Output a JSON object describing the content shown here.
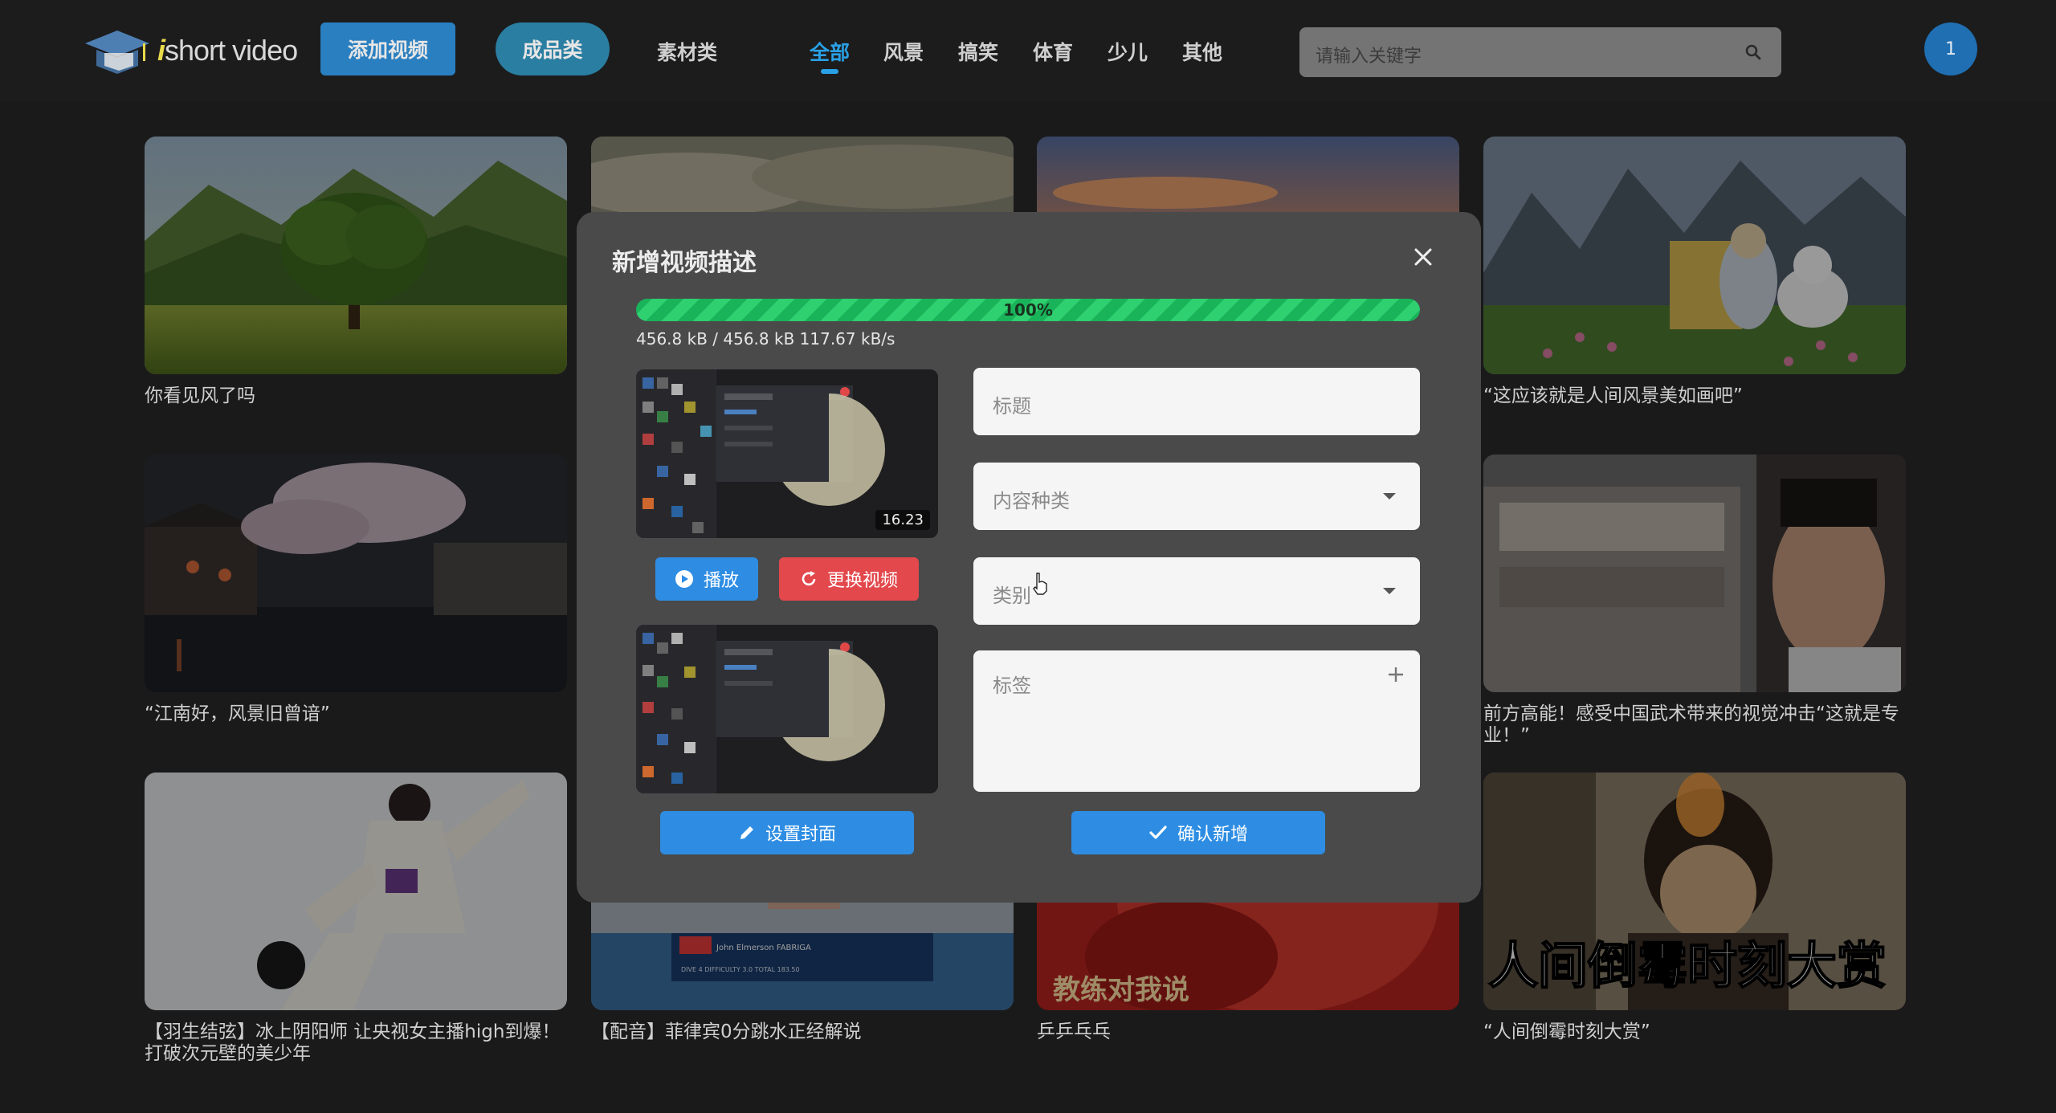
{
  "header": {
    "logo_text": "short video",
    "add_video_label": "添加视频",
    "finished_label": "成品类",
    "material_label": "素材类",
    "categories": [
      "全部",
      "风景",
      "搞笑",
      "体育",
      "少儿",
      "其他"
    ],
    "active_category": "全部",
    "search_placeholder": "请输入关键字",
    "avatar_text": "1"
  },
  "cards": [
    {
      "caption": "你看见风了吗"
    },
    {
      "caption": ""
    },
    {
      "caption": ""
    },
    {
      "caption": "“这应该就是人间风景美如画吧”"
    },
    {
      "caption": "“江南好，风景旧曾谙”"
    },
    {
      "caption": ""
    },
    {
      "caption": ""
    },
    {
      "caption": "前方高能！感受中国武术带来的视觉冲击“这就是专业！”"
    },
    {
      "caption": "【羽生结弦】冰上阴阳师 让央视女主播high到爆！打破次元壁的美少年"
    },
    {
      "caption": "【配音】菲律宾0分跳水正经解说"
    },
    {
      "caption": "乒乒乓乓"
    },
    {
      "caption": "“人间倒霉时刻大赏”"
    }
  ],
  "thumb_overlays": {
    "dive_name": "John Elmerson FABRIGA",
    "dive_bar": "DIVE 4       DIFFICULTY 3.0       TOTAL  183.50",
    "coach_text": "教练对我说",
    "unlucky_text": "人间倒霉时刻大赏"
  },
  "modal": {
    "title": "新增视频描述",
    "progress_percent": 100,
    "progress_label": "100%",
    "progress_info": "456.8 kB / 456.8 kB 117.67 kB/s",
    "duration": "16.23",
    "play_label": "播放",
    "replace_label": "更换视频",
    "cover_label": "设置封面",
    "confirm_label": "确认新增",
    "title_placeholder": "标题",
    "content_type_placeholder": "内容种类",
    "category_placeholder": "类别",
    "tags_placeholder": "标签"
  },
  "colors": {
    "accent": "#2e8de3",
    "danger": "#e3484c",
    "progress": "#19b35a",
    "active_nav": "#2aa0e6"
  }
}
